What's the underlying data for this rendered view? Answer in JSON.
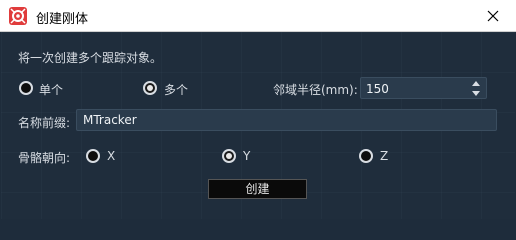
{
  "window": {
    "title": "创建刚体",
    "icon": "app-logo-icon",
    "close_icon": "close-icon"
  },
  "description": "将一次创建多个跟踪对象。",
  "count_mode": {
    "options": [
      {
        "label": "单个",
        "checked": false
      },
      {
        "label": "多个",
        "checked": true
      }
    ]
  },
  "radius": {
    "label": "邻域半径(mm):",
    "value": "150"
  },
  "name_prefix": {
    "label": "名称前缀:",
    "value": "MTracker"
  },
  "bone_axis": {
    "label": "骨骼朝向:",
    "options": [
      {
        "label": "X",
        "checked": false
      },
      {
        "label": "Y",
        "checked": true
      },
      {
        "label": "Z",
        "checked": false
      }
    ]
  },
  "create_button": "创建",
  "colors": {
    "background": "#1f2d3c",
    "field": "#2a3b4c",
    "titlebar": "#ffffff",
    "logo": "#e03c3c"
  }
}
